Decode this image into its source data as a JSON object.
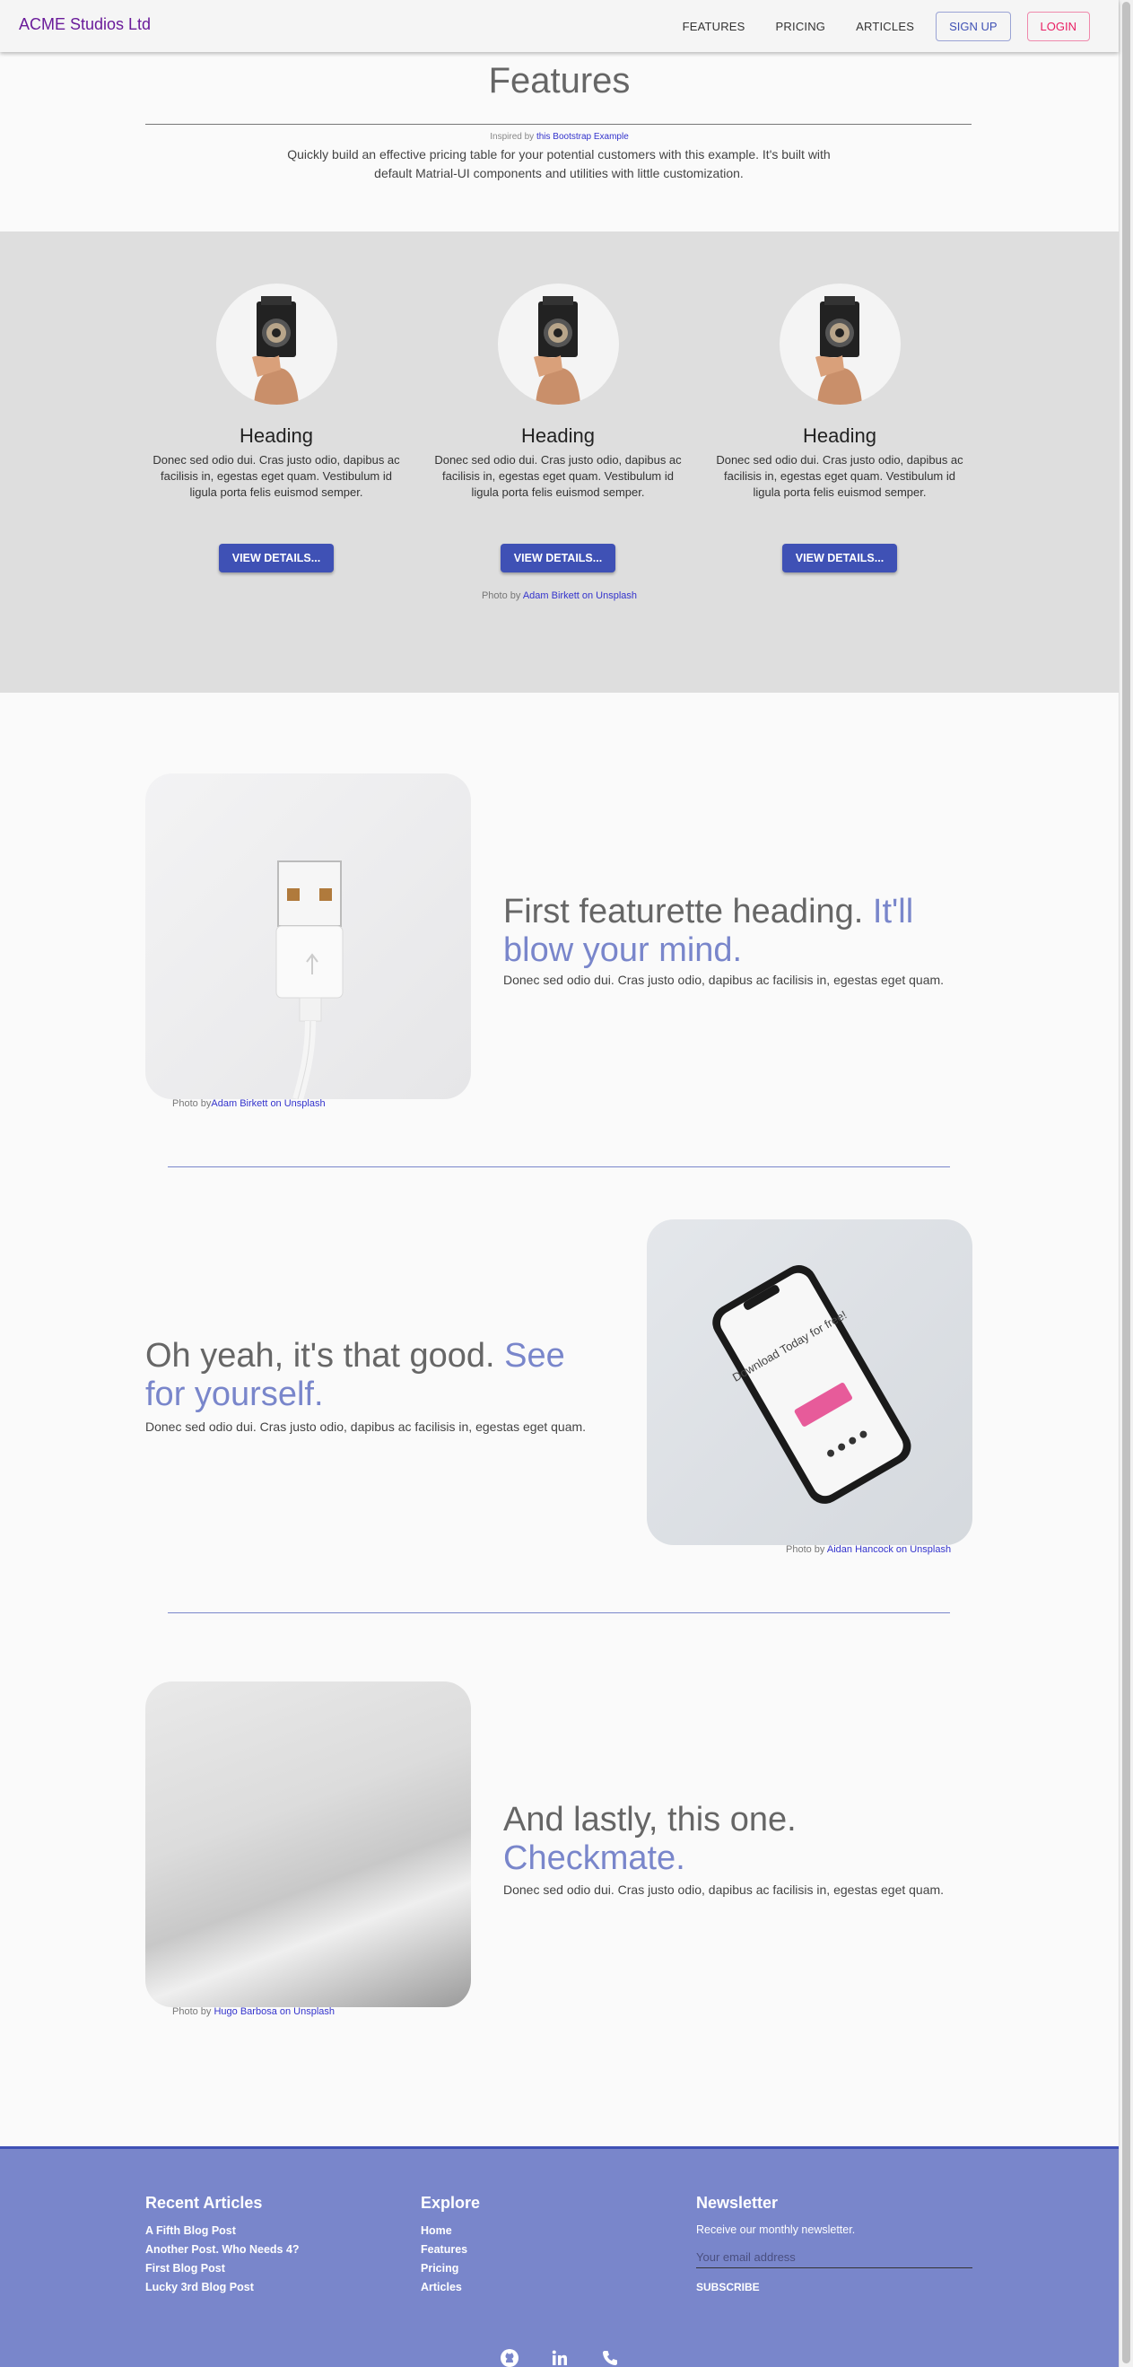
{
  "header": {
    "brand": "ACME Studios Ltd",
    "nav": [
      "FEATURES",
      "PRICING",
      "ARTICLES"
    ],
    "signup": "SIGN UP",
    "login": "LOGIN"
  },
  "hero": {
    "title": "Features",
    "inspired_prefix": "Inspired by ",
    "inspired_link": "this Bootstrap Example",
    "description": "Quickly build an effective pricing table for your potential customers with this example. It's built with default Matrial-UI components and utilities with little customization."
  },
  "columns": [
    {
      "heading": "Heading",
      "text": "Donec sed odio dui. Cras justo odio, dapibus ac facilisis in, egestas eget quam. Vestibulum id ligula porta felis euismod semper.",
      "button": "VIEW DETAILS..."
    },
    {
      "heading": "Heading",
      "text": "Donec sed odio dui. Cras justo odio, dapibus ac facilisis in, egestas eget quam. Vestibulum id ligula porta felis euismod semper.",
      "button": "VIEW DETAILS..."
    },
    {
      "heading": "Heading",
      "text": "Donec sed odio dui. Cras justo odio, dapibus ac facilisis in, egestas eget quam. Vestibulum id ligula porta felis euismod semper.",
      "button": "VIEW DETAILS..."
    }
  ],
  "band_credit": {
    "prefix": "Photo by ",
    "link": "Adam Birkett on Unsplash"
  },
  "featurettes": [
    {
      "heading": "First featurette heading. ",
      "accent": "It'll blow your mind.",
      "text": "Donec sed odio dui. Cras justo odio, dapibus ac facilisis in, egestas eget quam.",
      "credit_prefix": "Photo by",
      "credit_link": "Adam Birkett on Unsplash"
    },
    {
      "heading": "Oh yeah, it's that good. ",
      "accent": "See for yourself.",
      "text": "Donec sed odio dui. Cras justo odio, dapibus ac facilisis in, egestas eget quam.",
      "credit_prefix": "Photo by ",
      "credit_link": "Aidan Hancock on Unsplash",
      "phone_text": "Download Today for free!"
    },
    {
      "heading": "And lastly, this one. ",
      "accent": "Checkmate.",
      "text": "Donec sed odio dui. Cras justo odio, dapibus ac facilisis in, egestas eget quam.",
      "credit_prefix": "Photo by ",
      "credit_link": "Hugo Barbosa on Unsplash"
    }
  ],
  "footer": {
    "recent_title": "Recent Articles",
    "recent": [
      "A Fifth Blog Post",
      "Another Post. Who Needs 4?",
      "First Blog Post",
      "Lucky 3rd Blog Post"
    ],
    "explore_title": "Explore",
    "explore": [
      "Home",
      "Features",
      "Pricing",
      "Articles"
    ],
    "newsletter_title": "Newsletter",
    "newsletter_sub": "Receive our monthly newsletter.",
    "email_placeholder": "Your email address",
    "subscribe": "SUBSCRIBE",
    "social_icons": [
      "github-icon",
      "linkedin-icon",
      "phone-icon"
    ]
  }
}
